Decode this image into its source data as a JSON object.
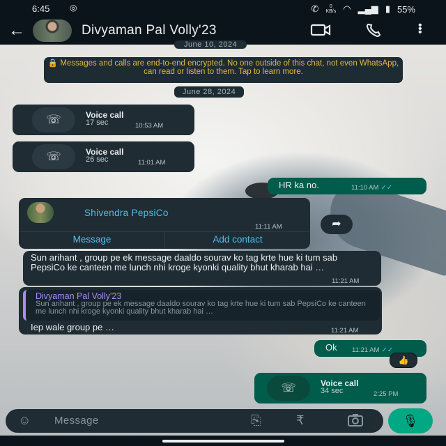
{
  "status_bar": {
    "time": "6:45",
    "kbs": "KB/s",
    "battery": "55%"
  },
  "header": {
    "back_glyph": "←",
    "contact_name": "Divyaman Pal Volly'23",
    "video_icon": "video-camera-icon",
    "call_icon": "phone-icon",
    "menu_icon": "more-vertical-icon"
  },
  "chat": {
    "date_1": "June 10, 2024",
    "encryption_notice": "🔒 Messages and calls are end-to-end encrypted. No one outside of this chat, not even WhatsApp, can read or listen to them. Tap to learn more.",
    "date_2": "June 28, 2024",
    "call_1": {
      "title": "Voice call",
      "duration": "17 sec",
      "time": "10:53 AM"
    },
    "call_2": {
      "title": "Voice call",
      "duration": "26 sec",
      "time": "11:01 AM"
    },
    "msg_hr": {
      "text": "HR ka no.",
      "time": "11:10 AM"
    },
    "contact_card": {
      "name": "Shivendra PepsiCo",
      "time": "11:11 AM",
      "message_button": "Message",
      "add_contact_button": "Add contact"
    },
    "msg_long": {
      "text": "Sun arihant , group pe ek message daaldo sourav ko tag krte hue ki tum sab PepsiCo ke canteen me lunch nhi kroge kyonki quality bhut kharab hai …",
      "time": "11:21 AM"
    },
    "msg_reply": {
      "quoted_name": "Divyaman Pal Volly'23",
      "quoted_text": "Sun arihant , group pe ek message daaldo sourav ko tag krte hue ki tum sab PepsiCo ke canteen me lunch nhi kroge kyonki quality bhut kharab hai …",
      "text": "Iep wale group pe …",
      "time": "11:21 AM"
    },
    "msg_ok": {
      "text": "Ok",
      "time": "11:21 AM",
      "reaction": "👍"
    },
    "call_3": {
      "title": "Voice call",
      "duration": "34 sec",
      "time": "2:25 PM"
    }
  },
  "input_bar": {
    "placeholder": "Message"
  },
  "colors": {
    "header_bg": "#0b141a",
    "incoming_bubble": "#1f2c34",
    "outgoing_bubble": "#005c4b",
    "accent": "#00a884",
    "link": "#53bdeb"
  }
}
